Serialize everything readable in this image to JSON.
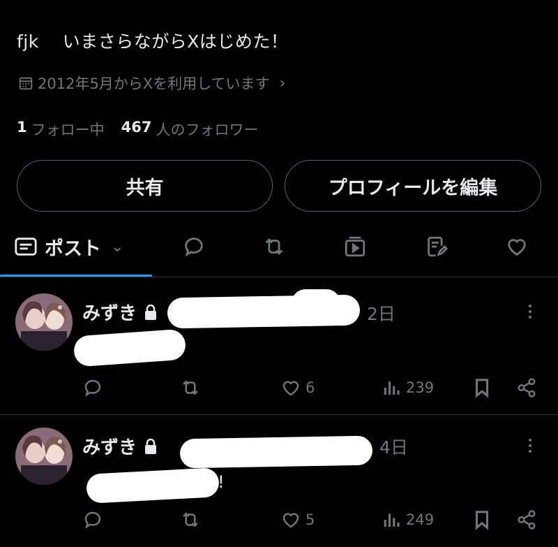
{
  "profile": {
    "bio_handle": "fjk",
    "bio_text": "いまさらながらXはじめた！",
    "joined_text": "2012年5月からXを利用しています",
    "following_count": "1",
    "following_label": "フォロー中",
    "followers_count": "467",
    "followers_label": "人のフォロワー"
  },
  "buttons": {
    "share_label": "共有",
    "edit_profile_label": "プロフィールを編集"
  },
  "tabs": {
    "posts_label": "ポスト",
    "icons": [
      "posts-icon",
      "replies-icon",
      "reposts-icon",
      "media-icon",
      "articles-icon",
      "likes-icon"
    ]
  },
  "posts": [
    {
      "author": "みずき",
      "time": "2日",
      "text": "",
      "likes": "6",
      "views": "239"
    },
    {
      "author": "みずき",
      "time": "4日",
      "text": "!",
      "likes": "5",
      "views": "249"
    }
  ],
  "colors": {
    "background": "#000000",
    "text_primary": "#e7e9ea",
    "text_secondary": "#71767b",
    "border": "#2f3336",
    "accent": "#1d9bf0"
  }
}
